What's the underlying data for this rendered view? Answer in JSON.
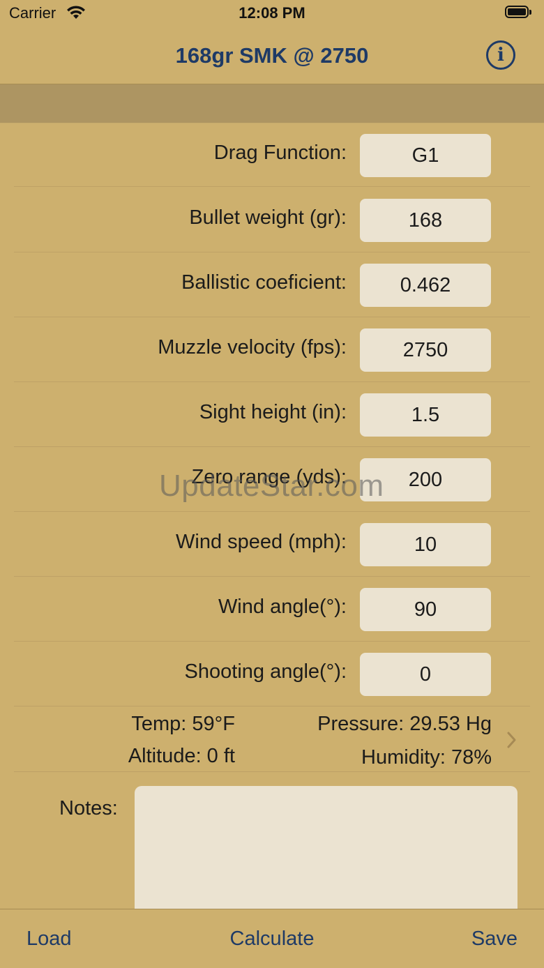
{
  "status_bar": {
    "carrier": "Carrier",
    "time": "12:08 PM"
  },
  "nav": {
    "title": "168gr SMK @ 2750"
  },
  "form": {
    "rows": [
      {
        "label": "Drag Function:",
        "value": "G1"
      },
      {
        "label": "Bullet weight (gr):",
        "value": "168"
      },
      {
        "label": "Ballistic coeficient:",
        "value": "0.462"
      },
      {
        "label": "Muzzle velocity (fps):",
        "value": "2750"
      },
      {
        "label": "Sight height (in):",
        "value": "1.5"
      },
      {
        "label": "Zero range (yds):",
        "value": "200"
      },
      {
        "label": "Wind speed (mph):",
        "value": "10"
      },
      {
        "label": "Wind angle(°):",
        "value": "90"
      },
      {
        "label": "Shooting angle(°):",
        "value": "0"
      }
    ]
  },
  "environment": {
    "temp": "Temp: 59°F",
    "altitude": "Altitude: 0 ft",
    "pressure": "Pressure: 29.53 Hg",
    "humidity": "Humidity: 78%"
  },
  "notes": {
    "label": "Notes:",
    "value": ""
  },
  "toolbar": {
    "load": "Load",
    "calculate": "Calculate",
    "save": "Save"
  },
  "watermark": "UpdateStar.com",
  "colors": {
    "background": "#cdb06e",
    "band": "#ad9562",
    "accent": "#1e3a66",
    "field": "#ebe3d1"
  },
  "icons": {
    "info": "info-icon",
    "chevron": "chevron-right-icon",
    "wifi": "wifi-icon",
    "battery": "battery-icon"
  }
}
